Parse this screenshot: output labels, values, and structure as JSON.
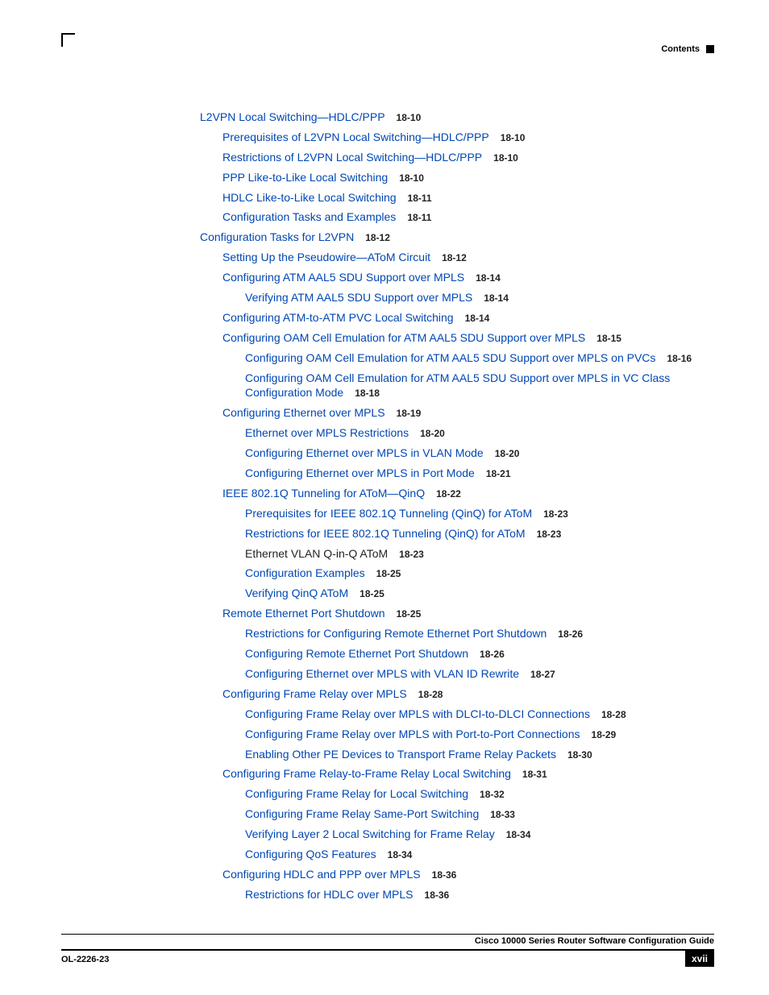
{
  "header": {
    "label": "Contents"
  },
  "footer": {
    "title": "Cisco 10000 Series Router Software Configuration Guide",
    "doc_id": "OL-2226-23",
    "page_num": "xvii"
  },
  "toc": [
    {
      "level": 0,
      "kind": "link",
      "title": "L2VPN Local Switching—HDLC/PPP",
      "page": "18-10"
    },
    {
      "level": 1,
      "kind": "link",
      "title": "Prerequisites of L2VPN Local Switching—HDLC/PPP",
      "page": "18-10"
    },
    {
      "level": 1,
      "kind": "link",
      "title": "Restrictions of L2VPN Local Switching—HDLC/PPP",
      "page": "18-10"
    },
    {
      "level": 1,
      "kind": "link",
      "title": "PPP Like-to-Like Local Switching",
      "page": "18-10"
    },
    {
      "level": 1,
      "kind": "link",
      "title": "HDLC Like-to-Like Local Switching",
      "page": "18-11"
    },
    {
      "level": 1,
      "kind": "link",
      "title": "Configuration Tasks and Examples",
      "page": "18-11"
    },
    {
      "level": 0,
      "kind": "link",
      "title": "Configuration Tasks for L2VPN",
      "page": "18-12"
    },
    {
      "level": 1,
      "kind": "link",
      "title": "Setting Up the Pseudowire—AToM Circuit",
      "page": "18-12"
    },
    {
      "level": 1,
      "kind": "link",
      "title": "Configuring ATM AAL5 SDU Support over MPLS",
      "page": "18-14"
    },
    {
      "level": 2,
      "kind": "link",
      "title": "Verifying ATM AAL5 SDU Support over MPLS",
      "page": "18-14"
    },
    {
      "level": 1,
      "kind": "link",
      "title": "Configuring ATM-to-ATM PVC Local Switching",
      "page": "18-14"
    },
    {
      "level": 1,
      "kind": "link",
      "title": "Configuring OAM Cell Emulation for ATM AAL5 SDU Support over MPLS",
      "page": "18-15"
    },
    {
      "level": 2,
      "kind": "link",
      "title": "Configuring OAM Cell Emulation for ATM AAL5 SDU Support over MPLS on PVCs",
      "page": "18-16"
    },
    {
      "level": 2,
      "kind": "link",
      "wrap": true,
      "title": "Configuring OAM Cell Emulation for ATM AAL5 SDU Support over MPLS in VC Class Configuration Mode",
      "page": "18-18"
    },
    {
      "level": 1,
      "kind": "link",
      "title": "Configuring Ethernet over MPLS",
      "page": "18-19"
    },
    {
      "level": 2,
      "kind": "link",
      "title": "Ethernet over MPLS Restrictions",
      "page": "18-20"
    },
    {
      "level": 2,
      "kind": "link",
      "title": "Configuring Ethernet over MPLS in VLAN Mode",
      "page": "18-20"
    },
    {
      "level": 2,
      "kind": "link",
      "title": "Configuring Ethernet over MPLS in Port Mode",
      "page": "18-21"
    },
    {
      "level": 1,
      "kind": "link",
      "title": "IEEE 802.1Q Tunneling for AToM—QinQ",
      "page": "18-22"
    },
    {
      "level": 2,
      "kind": "link",
      "title": "Prerequisites for IEEE 802.1Q Tunneling (QinQ) for AToM",
      "page": "18-23"
    },
    {
      "level": 2,
      "kind": "link",
      "title": "Restrictions for IEEE 802.1Q Tunneling (QinQ) for AToM",
      "page": "18-23"
    },
    {
      "level": 2,
      "kind": "plain",
      "title": "Ethernet VLAN Q-in-Q AToM",
      "page": "18-23"
    },
    {
      "level": 2,
      "kind": "link",
      "title": "Configuration Examples",
      "page": "18-25"
    },
    {
      "level": 2,
      "kind": "link",
      "title": "Verifying QinQ AToM",
      "page": "18-25"
    },
    {
      "level": 1,
      "kind": "link",
      "title": "Remote Ethernet Port Shutdown",
      "page": "18-25"
    },
    {
      "level": 2,
      "kind": "link",
      "title": "Restrictions for Configuring Remote Ethernet Port Shutdown",
      "page": "18-26"
    },
    {
      "level": 2,
      "kind": "link",
      "title": "Configuring Remote Ethernet Port Shutdown",
      "page": "18-26"
    },
    {
      "level": 2,
      "kind": "link",
      "title": "Configuring Ethernet over MPLS with VLAN ID Rewrite",
      "page": "18-27"
    },
    {
      "level": 1,
      "kind": "link",
      "title": "Configuring Frame Relay over MPLS",
      "page": "18-28"
    },
    {
      "level": 2,
      "kind": "link",
      "title": "Configuring Frame Relay over MPLS with DLCI-to-DLCI Connections",
      "page": "18-28"
    },
    {
      "level": 2,
      "kind": "link",
      "title": "Configuring Frame Relay over MPLS with Port-to-Port Connections",
      "page": "18-29"
    },
    {
      "level": 2,
      "kind": "link",
      "title": "Enabling Other PE Devices to Transport Frame Relay Packets",
      "page": "18-30"
    },
    {
      "level": 1,
      "kind": "link",
      "title": "Configuring Frame Relay-to-Frame Relay Local Switching",
      "page": "18-31"
    },
    {
      "level": 2,
      "kind": "link",
      "title": "Configuring Frame Relay for Local Switching",
      "page": "18-32"
    },
    {
      "level": 2,
      "kind": "link",
      "title": "Configuring Frame Relay Same-Port Switching",
      "page": "18-33"
    },
    {
      "level": 2,
      "kind": "link",
      "title": "Verifying Layer 2 Local Switching for Frame Relay",
      "page": "18-34"
    },
    {
      "level": 2,
      "kind": "link",
      "title": "Configuring QoS Features",
      "page": "18-34"
    },
    {
      "level": 1,
      "kind": "link",
      "title": "Configuring HDLC and PPP over MPLS",
      "page": "18-36"
    },
    {
      "level": 2,
      "kind": "link",
      "title": "Restrictions for HDLC over MPLS",
      "page": "18-36"
    }
  ]
}
